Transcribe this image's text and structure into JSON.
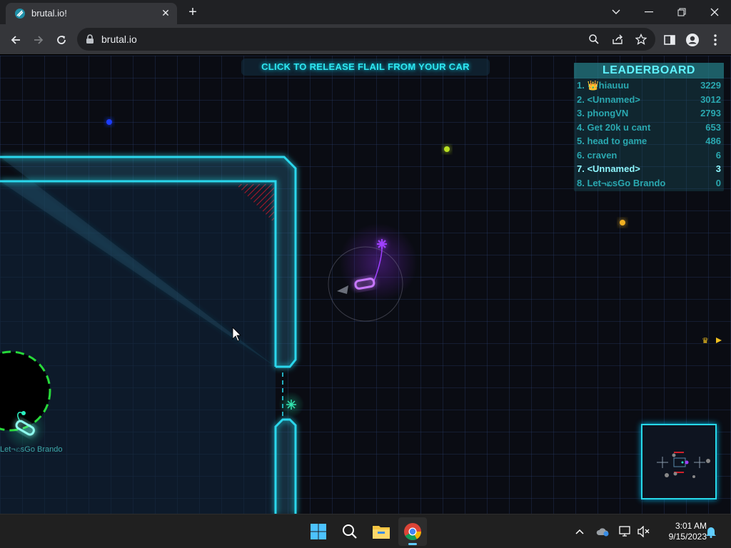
{
  "browser": {
    "tab_title": "brutal.io!",
    "url": "brutal.io",
    "icons": {
      "tab_close": "close-icon",
      "new_tab": "plus-icon",
      "back": "arrow-left-icon",
      "forward": "arrow-right-icon",
      "reload": "reload-icon",
      "lock": "lock-icon",
      "zoom": "search-icon",
      "share": "share-icon",
      "bookmark": "star-icon",
      "sidepanel": "sidepanel-icon",
      "profile": "profile-icon",
      "menu": "kebab-menu-icon"
    }
  },
  "game": {
    "hint": "CLICK TO RELEASE FLAIL FROM YOUR CAR",
    "player_label": "Let¬ಏsGo Brando",
    "leaderboard": {
      "title": "LEADERBOARD",
      "entries": [
        {
          "name": "1. 👑hiauuu",
          "score": "3229"
        },
        {
          "name": "2. <Unnamed>",
          "score": "3012"
        },
        {
          "name": "3. phongVN",
          "score": "2793"
        },
        {
          "name": "4. Get 20k u cant",
          "score": "653"
        },
        {
          "name": "5. head to game",
          "score": "486"
        },
        {
          "name": "6. craven",
          "score": "6"
        },
        {
          "name": "7. <Unnamed>",
          "score": "3"
        },
        {
          "name": "8. Let¬ಏsGo Brando",
          "score": "0"
        }
      ],
      "highlight_index": 6
    },
    "colors": {
      "wall": "#2ad7ec",
      "arena_fill": "#0d1a2a",
      "player_car": "#29f0c0",
      "enemy_car": "#a040ff",
      "danger": "#d0202a",
      "text_cyan": "#2fe6f0"
    }
  },
  "taskbar": {
    "time": "3:01 AM",
    "date": "9/15/2023",
    "apps": [
      "start-icon",
      "search-icon",
      "file-explorer-icon",
      "chrome-icon"
    ],
    "tray": [
      "chevron-up-icon",
      "onedrive-icon",
      "network-icon",
      "volume-muted-icon",
      "notification-bell-icon"
    ]
  }
}
